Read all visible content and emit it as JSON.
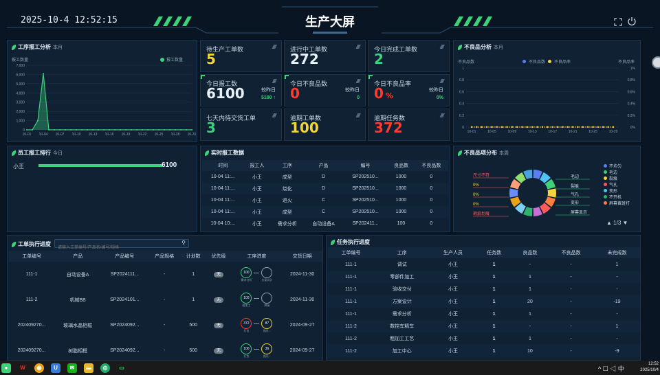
{
  "header": {
    "datetime": "2025-10-4 12:52:15",
    "title": "生产大屏",
    "left_stripes": "////",
    "right_stripes": "////"
  },
  "report_analysis": {
    "title": "工序报工分析",
    "sub": "本月",
    "ylabel": "报工数量",
    "legend": "报工数量"
  },
  "kpis": [
    {
      "label": "待生产工单数",
      "value": "5",
      "color": "#f5d33a"
    },
    {
      "label": "进行中工单数",
      "value": "272",
      "color": "#e8f0f8"
    },
    {
      "label": "今日完成工单数",
      "value": "2",
      "color": "#3ed17a"
    },
    {
      "label": "今日报工数",
      "value": "6100",
      "color": "#e8f0f8",
      "cmp_label": "较昨日",
      "cmp_value": "5100 ↑"
    },
    {
      "label": "今日不良品数",
      "value": "0",
      "color": "#ff3b30",
      "cmp_label": "较昨日",
      "cmp_value": "0"
    },
    {
      "label": "今日不良品率",
      "value": "0",
      "unit": "%",
      "color": "#ff3b30",
      "cmp_label": "较昨日",
      "cmp_value": "0%"
    },
    {
      "label": "七天内待交货工单",
      "value": "3",
      "color": "#3ed17a"
    },
    {
      "label": "逾期工单数",
      "value": "100",
      "color": "#f5d33a"
    },
    {
      "label": "逾期任务数",
      "value": "372",
      "color": "#ff3b30"
    }
  ],
  "defect_analysis": {
    "title": "不良品分析",
    "sub": "本月",
    "left_label": "不良品数",
    "right_label": "不良品率",
    "legend": [
      "不良品数",
      "不良品率"
    ]
  },
  "staff_rank": {
    "title": "员工报工排行",
    "sub": "今日",
    "name": "小王",
    "value": "6100",
    "fraction": 1.0
  },
  "realtime": {
    "title": "实时报工数据",
    "headers": [
      "时间",
      "报工人",
      "工序",
      "产品",
      "编号",
      "良品数",
      "不良品数"
    ],
    "rows": [
      [
        "10-04 11:...",
        "小王",
        "成型",
        "D",
        "SP202510...",
        "1000",
        "0"
      ],
      [
        "10-04 11:...",
        "小王",
        "烧化",
        "D",
        "SP202510...",
        "1000",
        "0"
      ],
      [
        "10-04 11:...",
        "小王",
        "退火",
        "C",
        "SP202510...",
        "1000",
        "0"
      ],
      [
        "10-04 11:...",
        "小王",
        "成型",
        "C",
        "SP202510...",
        "1000",
        "0"
      ],
      [
        "10-04 10:...",
        "小王",
        "需求分析",
        "自动设备A",
        "SP202411...",
        "100",
        "0"
      ]
    ]
  },
  "defect_dist": {
    "title": "不良品项分布",
    "sub": "本周",
    "labels_left": [
      "尺寸不符",
      "0%",
      "0%",
      "0%",
      "瑕疵划痕"
    ],
    "labels_right": [
      "毛边",
      "裂痕",
      "气孔",
      "变形",
      "屏幕显示"
    ],
    "legend": [
      "不均匀",
      "毛边",
      "裂痕",
      "气孔",
      "变形",
      "不开机",
      "屏幕黄斑打"
    ],
    "legend_colors": [
      "#5b7ff0",
      "#3ed17a",
      "#f5d33a",
      "#ff5a5a",
      "#4fc3f7",
      "#2fb36a",
      "#ff7f3e"
    ],
    "page": "1/3"
  },
  "workorder": {
    "title": "工单执行进度",
    "search_placeholder": "请输入工单编号/产品名/编号/规格",
    "headers": [
      "工单编号",
      "产品",
      "产品编号",
      "产品规格",
      "计划数",
      "优先级",
      "工序进度",
      "交货日期"
    ],
    "rows": [
      {
        "no": "111-1",
        "product": "自动设备A",
        "code": "SP2024111...",
        "spec": "-",
        "plan": "1",
        "priority": "无",
        "p1": "100",
        "p2": "",
        "s1": "需求分析",
        "s2": "方案设计",
        "date": "2024-11-30"
      },
      {
        "no": "111-2",
        "product": "机械BB",
        "code": "SP2024101...",
        "spec": "-",
        "plan": "1",
        "priority": "无",
        "p1": "100",
        "p2": "",
        "s1": "粗加工",
        "s2": "焊接",
        "date": "2024-11-30"
      },
      {
        "no": "202409270...",
        "product": "玻璃水晶相框",
        "code": "SP2024092...",
        "spec": "-",
        "plan": "500",
        "priority": "无",
        "p1": "372",
        "p2": "87",
        "s1": "打包",
        "s2": "抛光...",
        "date": "2024-09-27"
      },
      {
        "no": "202409270...",
        "product": "树脂相框",
        "code": "SP2024092...",
        "spec": "-",
        "plan": "500",
        "priority": "无",
        "p1": "100",
        "p2": "36",
        "s1": "打包",
        "s2": "抛光...",
        "date": "2024-09-27"
      }
    ]
  },
  "tasks": {
    "title": "任务执行进度",
    "headers": [
      "工单编号",
      "工序",
      "生产人员",
      "任务数",
      "良品数",
      "不良品数",
      "未完成数"
    ],
    "rows": [
      [
        "111-1",
        "调试",
        "小王",
        "1",
        "-",
        "-",
        "1"
      ],
      [
        "111-1",
        "零部件加工",
        "小王",
        "1",
        "1",
        "-",
        "-"
      ],
      [
        "111-1",
        "验收交付",
        "小王",
        "1",
        "1",
        "-",
        "-"
      ],
      [
        "111-1",
        "方案设计",
        "小王",
        "1",
        "20",
        "-",
        "-19"
      ],
      [
        "111-1",
        "需求分析",
        "小王",
        "1",
        "1",
        "-",
        "-"
      ],
      [
        "111-2",
        "数控车精车",
        "小王",
        "1",
        "-",
        "-",
        "1"
      ],
      [
        "111-2",
        "粗加工工艺",
        "小王",
        "1",
        "1",
        "-",
        "-"
      ],
      [
        "111-2",
        "加工中心",
        "小王",
        "1",
        "10",
        "-",
        "-9"
      ]
    ]
  },
  "taskbar": {
    "time": "12:52",
    "date": "2025/10/4",
    "ime": "中"
  },
  "chart_data": [
    {
      "type": "area",
      "title": "工序报工分析",
      "ylabel": "报工数量",
      "categories": [
        "10-01",
        "10-02",
        "10-03",
        "10-04",
        "10-05",
        "10-06",
        "10-07",
        "10-08",
        "10-09",
        "10-10",
        "10-11",
        "10-12",
        "10-13",
        "10-14",
        "10-15",
        "10-16",
        "10-17",
        "10-18",
        "10-19",
        "10-20",
        "10-21",
        "10-22",
        "10-23",
        "10-24",
        "10-25",
        "10-26",
        "10-27",
        "10-28",
        "10-29",
        "10-30",
        "10-31"
      ],
      "tick_labels": [
        "10-01",
        "10-04",
        "10-07",
        "10-10",
        "10-13",
        "10-16",
        "10-19",
        "10-22",
        "10-25",
        "10-28",
        "10-31"
      ],
      "series": [
        {
          "name": "报工数量",
          "values": [
            0,
            0,
            1000,
            6100,
            0,
            0,
            0,
            0,
            0,
            0,
            0,
            0,
            0,
            0,
            0,
            0,
            0,
            0,
            0,
            0,
            0,
            0,
            0,
            0,
            0,
            0,
            0,
            0,
            0,
            0,
            0
          ]
        }
      ],
      "yticks": [
        "0",
        "1,000",
        "2,000",
        "3,000",
        "4,000",
        "5,000",
        "6,000",
        "7,000"
      ],
      "ylim": [
        0,
        7000
      ],
      "color": "#3ed17a"
    },
    {
      "type": "line",
      "title": "不良品分析",
      "categories": [
        "10-01",
        "10-05",
        "10-09",
        "10-13",
        "10-17",
        "10-21",
        "10-25",
        "10-29"
      ],
      "tick_labels": [
        "10-01",
        "10-05",
        "10-09",
        "10-13",
        "10-17",
        "10-21",
        "10-25",
        "10-29"
      ],
      "series": [
        {
          "name": "不良品数",
          "values": [
            0,
            0,
            0,
            0,
            0,
            0,
            0,
            0
          ]
        },
        {
          "name": "不良品率",
          "values": [
            0,
            0,
            0,
            0,
            0,
            0,
            0,
            0
          ]
        }
      ],
      "yticks_left": [
        "0",
        "0.2",
        "0.4",
        "0.6",
        "0.8",
        "1"
      ],
      "yticks_right": [
        "0%",
        "0.2%",
        "0.4%",
        "0.6%",
        "0.8%",
        "1%"
      ],
      "ylim": [
        0,
        1
      ]
    }
  ]
}
